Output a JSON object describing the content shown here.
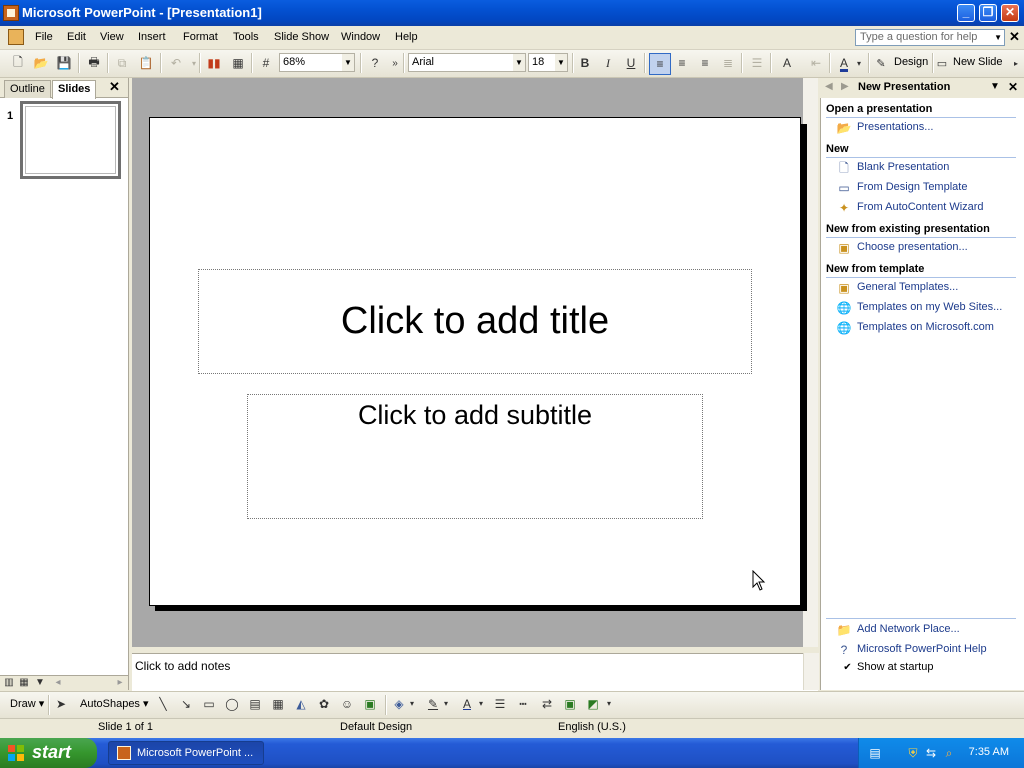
{
  "window": {
    "title": "Microsoft PowerPoint - [Presentation1]"
  },
  "menu": {
    "items": [
      "File",
      "Edit",
      "View",
      "Insert",
      "Format",
      "Tools",
      "Slide Show",
      "Window",
      "Help"
    ],
    "help_placeholder": "Type a question for help"
  },
  "toolbar": {
    "zoom": "68%",
    "font": "Arial",
    "size": "18",
    "design_label": "Design",
    "new_slide_label": "New Slide"
  },
  "left_pane": {
    "tabs": [
      "Outline",
      "Slides"
    ],
    "slide_number": "1"
  },
  "slide": {
    "title_placeholder": "Click to add title",
    "subtitle_placeholder": "Click to add subtitle"
  },
  "notes": {
    "placeholder": "Click to add notes"
  },
  "task_pane": {
    "title": "New Presentation",
    "sections": [
      {
        "heading": "Open a presentation",
        "links": [
          "Presentations..."
        ]
      },
      {
        "heading": "New",
        "links": [
          "Blank Presentation",
          "From Design Template",
          "From AutoContent Wizard"
        ]
      },
      {
        "heading": "New from existing presentation",
        "links": [
          "Choose presentation..."
        ]
      },
      {
        "heading": "New from template",
        "links": [
          "General Templates...",
          "Templates on my Web Sites...",
          "Templates on Microsoft.com"
        ]
      }
    ],
    "footer_links": [
      "Add Network Place...",
      "Microsoft PowerPoint Help"
    ],
    "show_at_startup": "Show at startup"
  },
  "drawing_toolbar": {
    "draw_label": "Draw",
    "autoshapes_label": "AutoShapes"
  },
  "status": {
    "slide": "Slide 1 of 1",
    "design": "Default Design",
    "language": "English (U.S.)"
  },
  "taskbar": {
    "start_label": "start",
    "window_button": "Microsoft PowerPoint ...",
    "time": "7:35 AM"
  },
  "colors": {
    "link": "#1d3b8c",
    "titlebar": "#0350d0",
    "start": "#35962d"
  }
}
